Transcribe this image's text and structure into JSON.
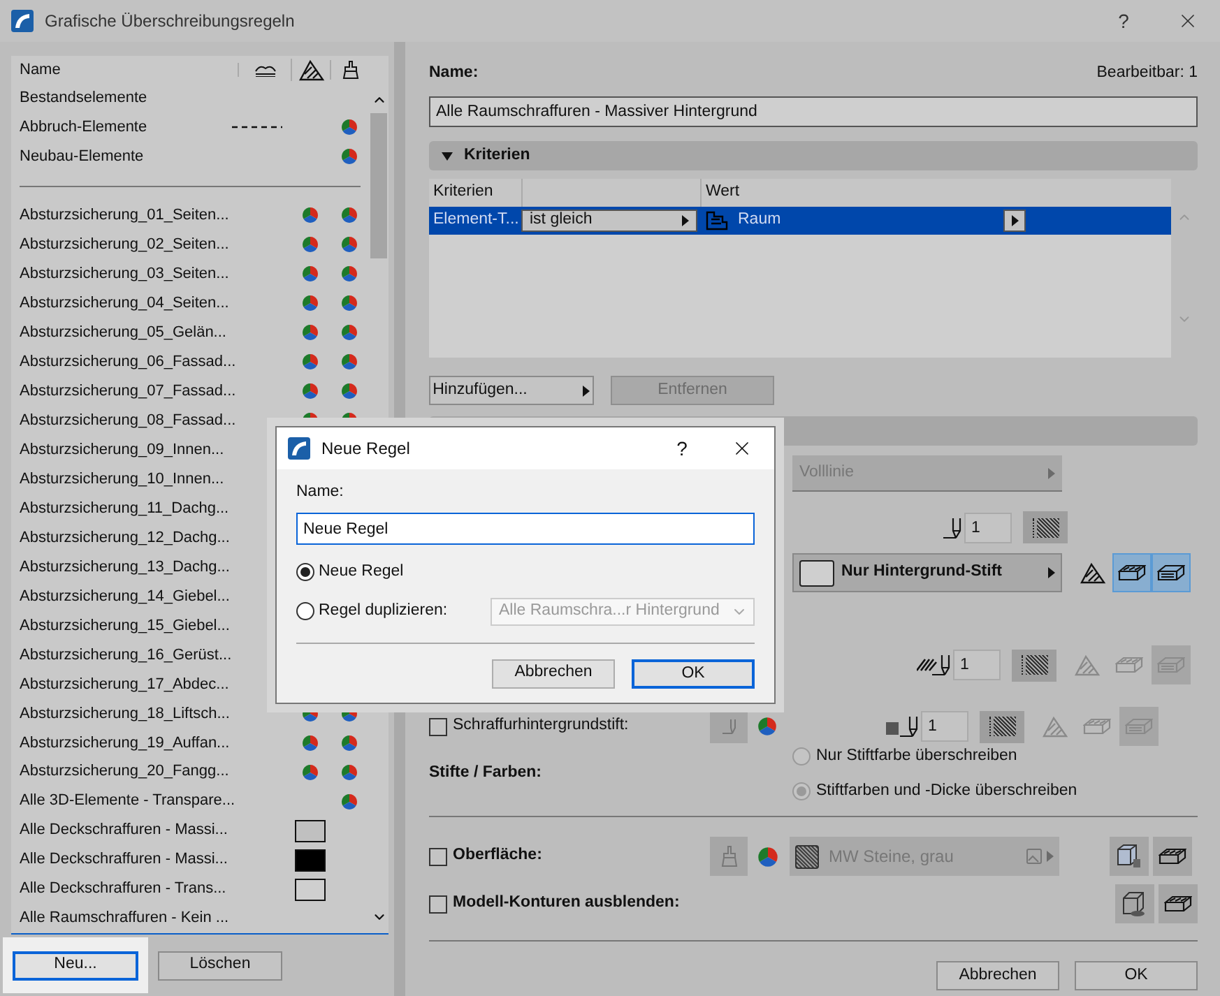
{
  "window": {
    "title": "Grafische Überschreibungsregeln",
    "help": "?"
  },
  "rules_list": {
    "name_header": "Name",
    "base_rules": [
      {
        "name": "Bestandselemente",
        "dashed": false,
        "surface_override": false
      },
      {
        "name": "Abbruch-Elemente",
        "dashed": true,
        "surface_override": true
      },
      {
        "name": "Neubau-Elemente",
        "dashed": false,
        "surface_override": true
      }
    ],
    "rules": [
      {
        "name": "Absturzsicherung_01_Seiten...",
        "fill_override": true,
        "surface_override": true
      },
      {
        "name": "Absturzsicherung_02_Seiten...",
        "fill_override": true,
        "surface_override": true
      },
      {
        "name": "Absturzsicherung_03_Seiten...",
        "fill_override": true,
        "surface_override": true
      },
      {
        "name": "Absturzsicherung_04_Seiten...",
        "fill_override": true,
        "surface_override": true
      },
      {
        "name": "Absturzsicherung_05_Gelän...",
        "fill_override": true,
        "surface_override": true
      },
      {
        "name": "Absturzsicherung_06_Fassad...",
        "fill_override": true,
        "surface_override": true
      },
      {
        "name": "Absturzsicherung_07_Fassad...",
        "fill_override": true,
        "surface_override": true
      },
      {
        "name": "Absturzsicherung_08_Fassad...",
        "fill_override": true,
        "surface_override": true
      },
      {
        "name": "Absturzsicherung_09_Innen..."
      },
      {
        "name": "Absturzsicherung_10_Innen..."
      },
      {
        "name": "Absturzsicherung_11_Dachg..."
      },
      {
        "name": "Absturzsicherung_12_Dachg..."
      },
      {
        "name": "Absturzsicherung_13_Dachg..."
      },
      {
        "name": "Absturzsicherung_14_Giebel..."
      },
      {
        "name": "Absturzsicherung_15_Giebel..."
      },
      {
        "name": "Absturzsicherung_16_Gerüst..."
      },
      {
        "name": "Absturzsicherung_17_Abdec..."
      },
      {
        "name": "Absturzsicherung_18_Liftsch...",
        "fill_override": true,
        "surface_override": true
      },
      {
        "name": "Absturzsicherung_19_Auffan...",
        "fill_override": true,
        "surface_override": true
      },
      {
        "name": "Absturzsicherung_20_Fangg...",
        "fill_override": true,
        "surface_override": true
      },
      {
        "name": "Alle 3D-Elemente - Transpare...",
        "fill_override": false,
        "surface_override": true
      },
      {
        "name": "Alle Deckschraffuren - Massi...",
        "color": "#c0c0c0",
        "surface_override": false
      },
      {
        "name": "Alle Deckschraffuren - Massi...",
        "color": "#000000",
        "surface_override": false
      },
      {
        "name": "Alle Deckschraffuren - Trans...",
        "color": "#cfcfcf",
        "surface_override": false
      },
      {
        "name": "Alle Raumschraffuren - Kein ...",
        "fill_override": false,
        "surface_override": false
      }
    ],
    "buttons": {
      "new": "Neu...",
      "delete": "Löschen"
    }
  },
  "rule": {
    "name_label": "Name:",
    "editable": "Bearbeitbar: 1",
    "name_value": "Alle Raumschraffuren - Massiver Hintergrund"
  },
  "criteria": {
    "title": "Kriterien",
    "expanded": true,
    "column_1": "Kriterien",
    "column_3": "Wert",
    "rows": [
      {
        "criterion": "Element-T...",
        "operator": "ist gleich",
        "value": "Raum",
        "selected": true
      }
    ],
    "add_button": "Hinzufügen...",
    "remove_button": {
      "label": "Entfernen",
      "disabled": true
    }
  },
  "style": {
    "line_type": {
      "value": "Volllinie",
      "disabled": true
    },
    "line_pen": "1",
    "fill_type": "Nur Hintergrund-Stift",
    "fill_modes": [
      {
        "selected": false
      },
      {
        "selected": true
      },
      {
        "selected": true
      }
    ],
    "hatch_pen": "1",
    "background_pen": {
      "label": "Schraffurhintergrundstift:",
      "checked": false,
      "value": "1"
    },
    "pens_colors": {
      "label": "Stifte / Farben:",
      "disabled": true,
      "options": [
        {
          "label": "Nur Stiftfarbe überschreiben",
          "selected": false
        },
        {
          "label": "Stiftfarben und -Dicke überschreiben",
          "selected": true
        }
      ]
    },
    "surface": {
      "label": "Oberfläche:",
      "checked": false,
      "value": "MW Steine, grau"
    },
    "hide_contours": {
      "label": "Modell-Konturen ausblenden:",
      "checked": false
    }
  },
  "footer": {
    "cancel": "Abbrechen",
    "ok": "OK"
  },
  "dialog": {
    "title": "Neue Regel",
    "help": "?",
    "name_label": "Name:",
    "name_value": "Neue Regel",
    "options": [
      {
        "label": "Neue Regel",
        "selected": true
      },
      {
        "label": "Regel duplizieren:",
        "selected": false
      }
    ],
    "duplicate_source": "Alle Raumschra...r Hintergrund",
    "cancel": "Abbrechen",
    "ok": "OK"
  }
}
